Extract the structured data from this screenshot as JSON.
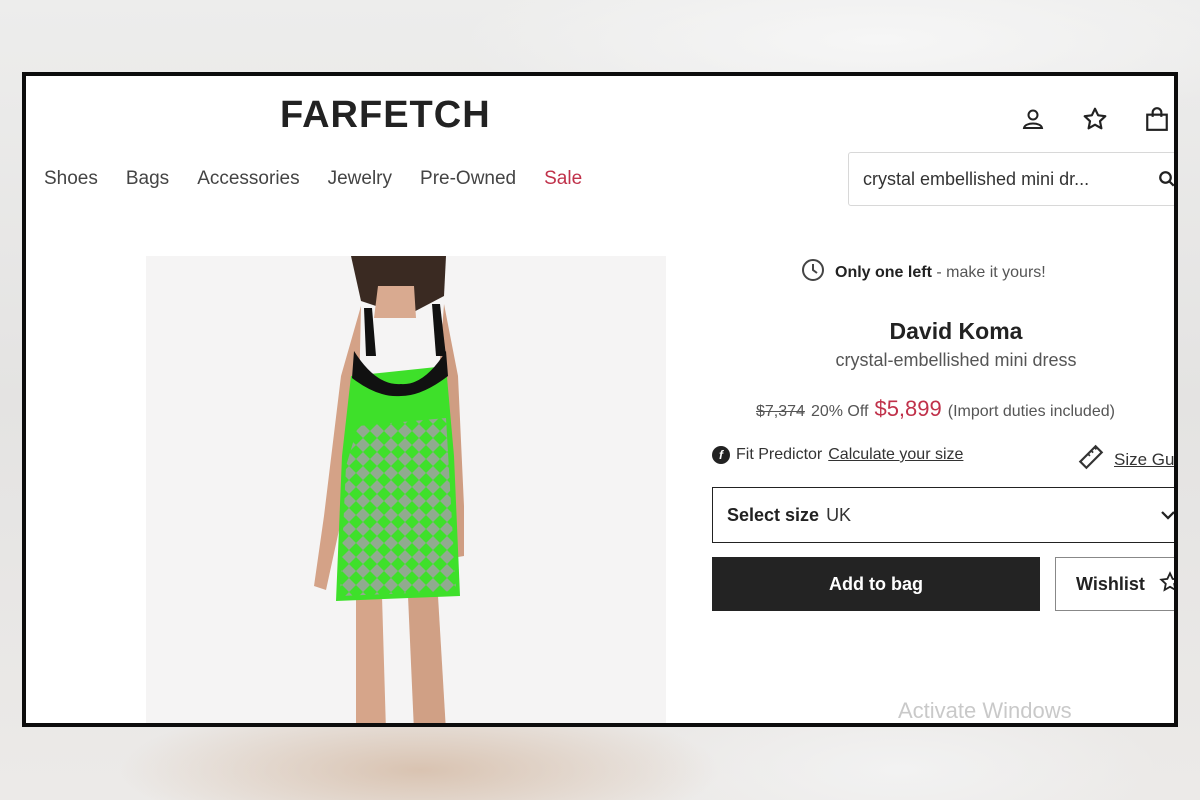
{
  "header": {
    "logo": "FARFETCH",
    "icons": [
      "account-icon",
      "wishlist-star-icon",
      "bag-icon"
    ]
  },
  "nav": {
    "items": [
      "Shoes",
      "Bags",
      "Accessories",
      "Jewelry",
      "Pre-Owned",
      "Sale"
    ]
  },
  "search": {
    "value": "crystal embellished mini dr..."
  },
  "product": {
    "stock_bold": "Only one left",
    "stock_rest": "- make it yours!",
    "brand": "David Koma",
    "name": "crystal-embellished mini dress",
    "old_price": "$7,374",
    "discount": "20% Off",
    "new_price": "$5,899",
    "duties": "(Import duties included)",
    "fit_label": "Fit Predictor",
    "fit_link": "Calculate your size",
    "size_guide": "Size Gu",
    "select_label": "Select size",
    "select_value": "UK",
    "add_to_bag": "Add to bag",
    "wishlist": "Wishlist"
  },
  "watermark": "Activate Windows",
  "colors": {
    "sale": "#c0314a",
    "button": "#232323",
    "dress": "#3ee02a"
  }
}
